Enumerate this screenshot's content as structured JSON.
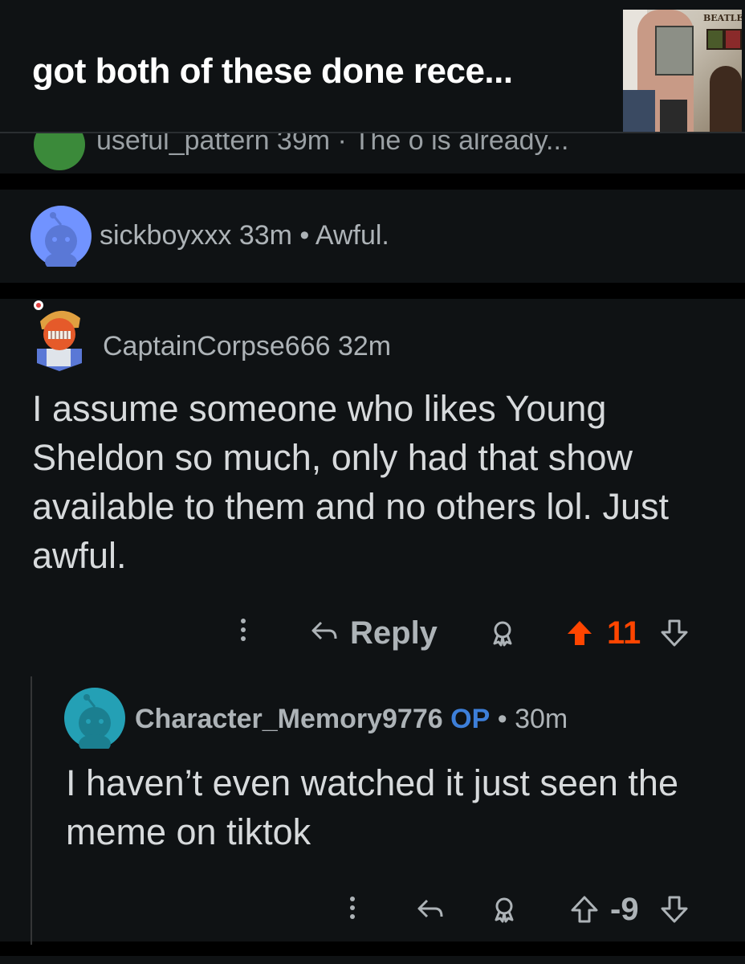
{
  "header": {
    "post_title": "got both of these done rece...",
    "thumbnail_text": "BEATLE"
  },
  "cut_comment": {
    "text": "useful_pattern 39m · The o is already..."
  },
  "comments": [
    {
      "username": "sickboyxxx",
      "time": "33m",
      "separator": "•",
      "preview": "Awful."
    },
    {
      "username": "CaptainCorpse666",
      "time": "32m",
      "body": "I assume someone who likes Young Sheldon so much, only had that show available to them and no others lol. Just awful.",
      "actions": {
        "more_icon": "more-vertical-icon",
        "reply_label": "Reply",
        "award_icon": "award-icon",
        "vote_count": "11",
        "vote_state": "upvoted"
      }
    },
    {
      "username": "Character_Memory9776",
      "op_label": "OP",
      "separator": "•",
      "time": "30m",
      "body": "I haven’t even watched it just seen the meme on tiktok",
      "actions": {
        "more_icon": "more-vertical-icon",
        "award_icon": "award-icon",
        "vote_count": "-9",
        "vote_state": "none"
      }
    }
  ],
  "colors": {
    "background": "#000000",
    "card": "#0f1214",
    "text": "#d7dadc",
    "meta": "#adb3b7",
    "upvote": "#ff4500",
    "op": "#3d7fd9",
    "snoo_blue": "#7193ff",
    "snoo_teal": "#24a0b5"
  }
}
